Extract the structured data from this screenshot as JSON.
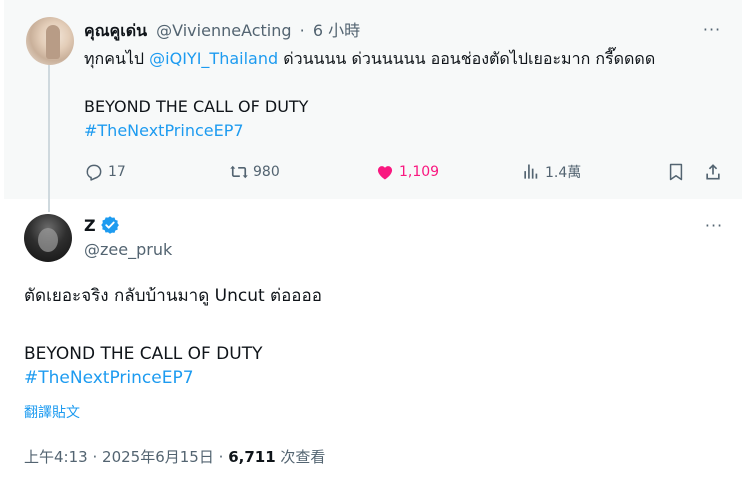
{
  "parent_tweet": {
    "display_name": "คุณคูเด่น",
    "handle": "@VivienneActing",
    "separator": "·",
    "time": "6 小時",
    "text_prefix": "ทุกคนไป ",
    "mention": "@iQIYI_Thailand",
    "text_suffix": " ด่วนนนน ด่วนนนนน ออนช่องตัดไปเยอะมาก กรี๊ดดดด",
    "line2": "BEYOND THE CALL OF DUTY",
    "hashtag": "#TheNextPrinceEP7",
    "replies": "17",
    "reposts": "980",
    "likes": "1,109",
    "views": "1.4萬",
    "more_label": "···"
  },
  "main_tweet": {
    "display_name": "Z",
    "verified": true,
    "handle": "@zee_pruk",
    "line1": "ตัดเยอะจริง กลับบ้านมาดู Uncut ต่ออออ",
    "line2": "BEYOND THE CALL OF DUTY",
    "hashtag": "#TheNextPrinceEP7",
    "translate_label": "翻譯貼文",
    "time": "上午4:13",
    "separator": "·",
    "date": "2025年6月15日",
    "separator2": "·",
    "views": "6,711",
    "views_label": "次查看",
    "more_label": "···"
  },
  "colors": {
    "accent": "#1d9bf0",
    "like": "#f91880",
    "muted": "#536471",
    "parent_bg": "#f7f9f9"
  }
}
